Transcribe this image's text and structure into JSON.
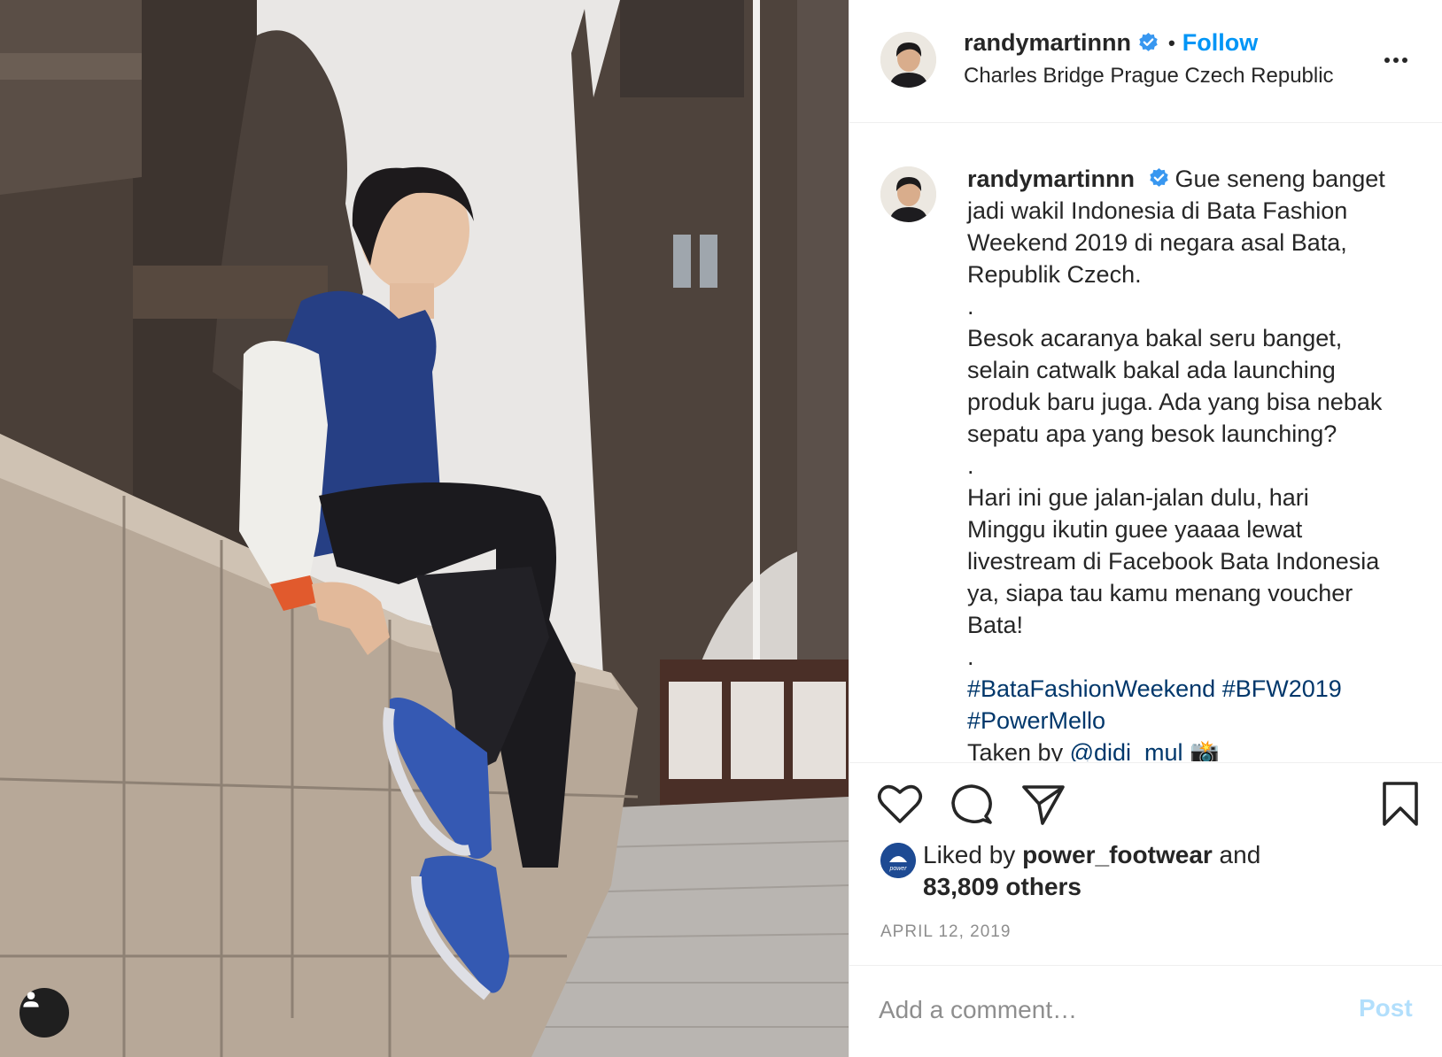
{
  "post": {
    "username": "randymartinnn",
    "verified_icon": "verified-badge-icon",
    "separator": "•",
    "follow_label": "Follow",
    "location": "Charles Bridge Prague Czech Republic",
    "more_icon": "more-options-icon"
  },
  "caption": {
    "username": "randymartinnn",
    "lines": [
      "Gue seneng banget",
      "jadi wakil Indonesia di Bata Fashion",
      "Weekend 2019 di negara asal Bata,",
      "Republik Czech.",
      ".",
      "Besok acaranya bakal seru banget,",
      "selain catwalk bakal ada launching",
      "produk baru juga. Ada yang bisa nebak",
      "sepatu apa yang besok launching?",
      ".",
      "Hari ini gue jalan-jalan dulu, hari",
      "Minggu ikutin guee yaaaa lewat",
      "livestream di Facebook Bata Indonesia",
      "ya, siapa tau kamu menang voucher",
      "Bata!",
      "."
    ],
    "hashtags_line1": "#BataFashionWeekend #BFW2019",
    "hashtags_line2": "#PowerMello",
    "taken_by_prefix": "Taken by ",
    "taken_by_user": "@didi_mul",
    "taken_by_emoji": "📸"
  },
  "actions": {
    "like_icon": "heart-icon",
    "comment_icon": "comment-icon",
    "share_icon": "share-icon",
    "save_icon": "bookmark-icon"
  },
  "likes": {
    "prefix": "Liked by ",
    "liker": "power_footwear",
    "middle": " and",
    "count_text": "83,809 others",
    "liker_avatar_text": "power"
  },
  "date": "APRIL 12, 2019",
  "comment": {
    "placeholder": "Add a comment…",
    "post_label": "Post"
  },
  "colors": {
    "accent": "#0095f6",
    "hashtag": "#00376b",
    "post_disabled": "#b2dffc",
    "verified": "#3897f0",
    "muted": "#8e8e8e"
  }
}
